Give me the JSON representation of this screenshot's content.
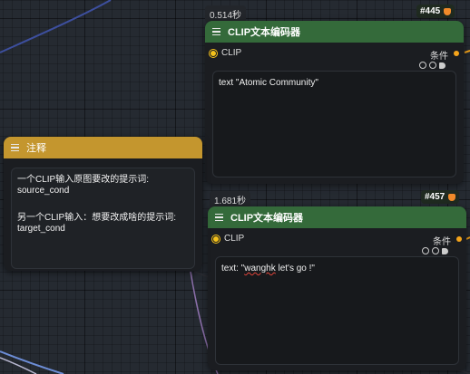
{
  "node_445": {
    "time": "0.514秒",
    "id": "#445",
    "title": "CLIP文本编码器",
    "input_label": "CLIP",
    "output_label": "条件",
    "text": "text \"Atomic Community\""
  },
  "node_457": {
    "time": "1.681秒",
    "id": "#457",
    "title": "CLIP文本编码器",
    "input_label": "CLIP",
    "output_label": "条件",
    "text_prefix": "text: \"",
    "text_misspelled": "wanghk",
    "text_suffix": " let's go !\""
  },
  "note": {
    "title": "注释",
    "line1": "一个CLIP输入原图要改的提示词:",
    "line2": "source_cond",
    "line3": "另一个CLIP输入：想要改成啥的提示词:",
    "line4": "target_cond"
  },
  "colors": {
    "header_green": "#346a3a",
    "header_gold": "#c4962e",
    "clip_input": "#f5c21b",
    "cond_output": "#f5a41b"
  }
}
